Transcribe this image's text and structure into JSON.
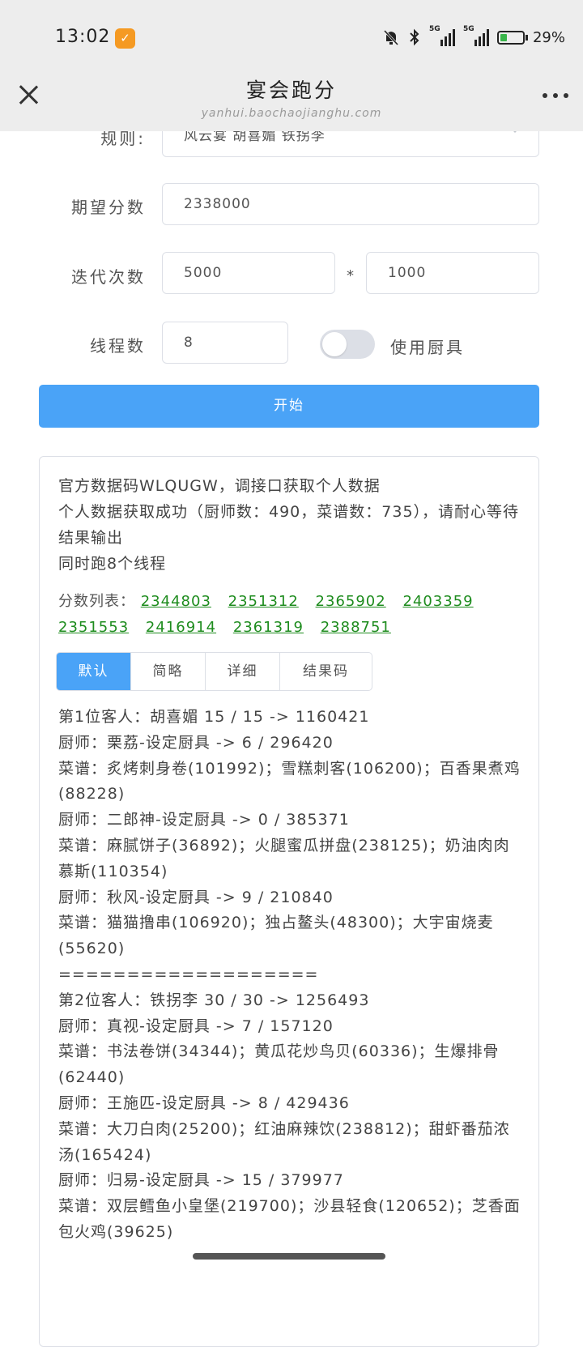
{
  "status_bar": {
    "time": "13:02",
    "signal1_label": "5G",
    "signal2_label": "5G",
    "battery_percent": "29%",
    "battery_level": 0.29,
    "icons": [
      "app-badge-icon",
      "mute-icon",
      "bluetooth-icon",
      "signal-icon",
      "battery-icon"
    ]
  },
  "nav": {
    "title": "宴会跑分",
    "subtitle": "yanhui.baochaojianghu.com"
  },
  "form": {
    "rule_label": "规则:",
    "rule_value": "风云宴 胡喜媚 铁拐李",
    "expect_label": "期望分数",
    "expect_value": "2338000",
    "iter_label": "迭代次数",
    "iter_value1": "5000",
    "iter_sep": "*",
    "iter_value2": "1000",
    "thread_label": "线程数",
    "thread_value": "8",
    "toggle_label": "使用厨具",
    "toggle_on": false,
    "start_label": "开始"
  },
  "log": [
    "官方数据码WLQUGW，调接口获取个人数据",
    "个人数据获取成功（厨师数：490，菜谱数：735），请耐心等待结果输出",
    "同时跑8个线程"
  ],
  "scores": {
    "label": "分数列表：",
    "values": [
      "2344803",
      "2351312",
      "2365902",
      "2403359",
      "2351553",
      "2416914",
      "2361319",
      "2388751"
    ]
  },
  "tabs": [
    "默认",
    "简略",
    "详细",
    "结果码"
  ],
  "results": [
    "第1位客人：胡喜媚 15 / 15 -> 1160421",
    "厨师：栗荔-设定厨具 -> 6 / 296420",
    "菜谱：炙烤刺身卷(101992)；雪糕刺客(106200)；百香果煮鸡(88228)",
    "厨师：二郎神-设定厨具 -> 0 / 385371",
    "菜谱：麻腻饼子(36892)；火腿蜜瓜拼盘(238125)；奶油肉肉慕斯(110354)",
    "厨师：秋风-设定厨具 -> 9 / 210840",
    "菜谱：猫猫撸串(106920)；独占鳌头(48300)；大宇宙烧麦(55620)",
    "===================",
    "第2位客人：铁拐李 30 / 30 -> 1256493",
    "厨师：真视-设定厨具 -> 7 / 157120",
    "菜谱：书法卷饼(34344)；黄瓜花炒鸟贝(60336)；生爆排骨(62440)",
    "厨师：王施匹-设定厨具 -> 8 / 429436",
    "菜谱：大刀白肉(25200)；红油麻辣饮(238812)；甜虾番茄浓汤(165424)",
    "厨师：归易-设定厨具 -> 15 / 379977",
    "菜谱：双层鳕鱼小皇堡(219700)；沙县轻食(120652)；芝香面包火鸡(39625)"
  ]
}
